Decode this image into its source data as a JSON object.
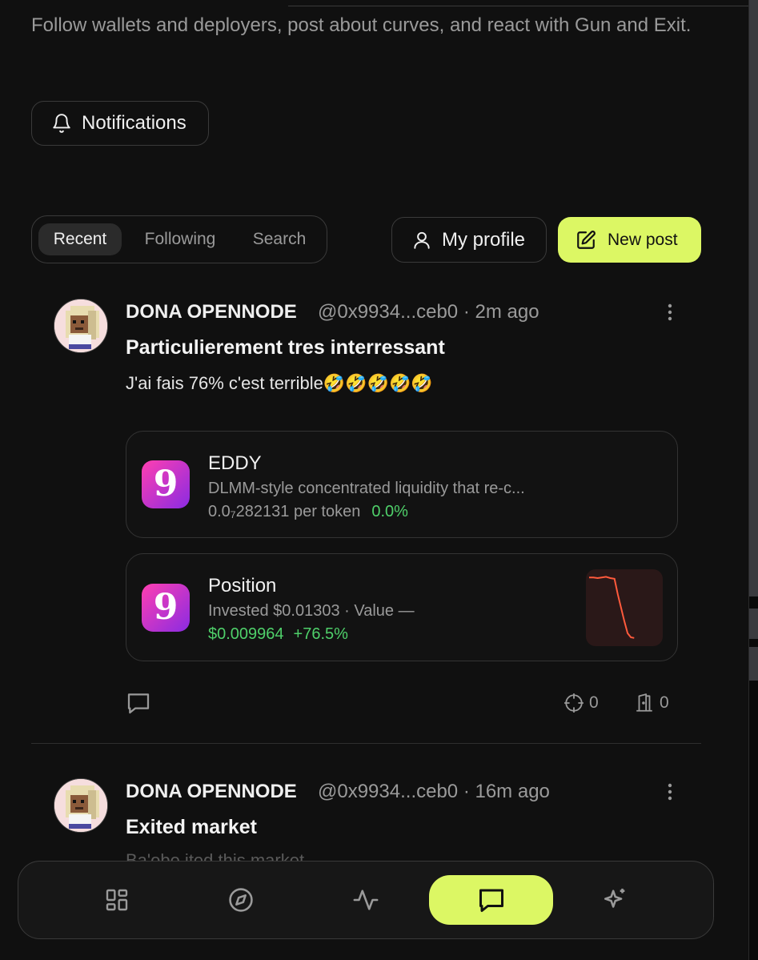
{
  "intro": {
    "text": "Follow wallets and deployers, post about curves, and react with Gun and Exit."
  },
  "notifications": {
    "label": "Notifications"
  },
  "tabs": [
    {
      "label": "Recent",
      "active": true
    },
    {
      "label": "Following",
      "active": false
    },
    {
      "label": "Search",
      "active": false
    }
  ],
  "actions": {
    "my_profile": "My profile",
    "new_post": "New post"
  },
  "colors": {
    "accent": "#dcf764",
    "background": "#101010",
    "positive": "#4fd06a",
    "token_gradient_start": "#ff3fb1",
    "token_gradient_end": "#8a2be2"
  },
  "posts": [
    {
      "author": "DONA OPENNODE",
      "handle": "@0x9934...ceb0",
      "time": "· 2m ago",
      "title": "Particulierement tres interressant",
      "body": "J'ai fais 76% c'est terrible🤣🤣🤣🤣🤣",
      "token_card": {
        "icon_glyph": "9",
        "name": "EDDY",
        "description": "DLMM-style concentrated liquidity that re-c...",
        "price": "0.0₇282131 per token",
        "change": "0.0%"
      },
      "position_card": {
        "icon_glyph": "9",
        "title": "Position",
        "invested": "Invested $0.01303 · Value —",
        "value": "$0.009964",
        "pnl": "+76.5%",
        "sparkline": [
          0.95,
          0.95,
          0.94,
          0.95,
          0.96,
          0.94,
          0.93,
          0.7,
          0.5,
          0.3,
          0.12,
          0.06,
          0.05
        ]
      },
      "reactions": {
        "gun_count": "0",
        "exit_count": "0"
      }
    },
    {
      "author": "DONA OPENNODE",
      "handle": "@0x9934...ceb0",
      "time": "· 16m ago",
      "title": "Exited market",
      "body": "Ba'obe ited this market..."
    }
  ],
  "nav": [
    {
      "icon": "dashboard-grid-icon",
      "active": false
    },
    {
      "icon": "compass-icon",
      "active": false
    },
    {
      "icon": "activity-pulse-icon",
      "active": false
    },
    {
      "icon": "chat-bubble-icon",
      "active": true
    },
    {
      "icon": "sparkles-icon",
      "active": false
    }
  ]
}
